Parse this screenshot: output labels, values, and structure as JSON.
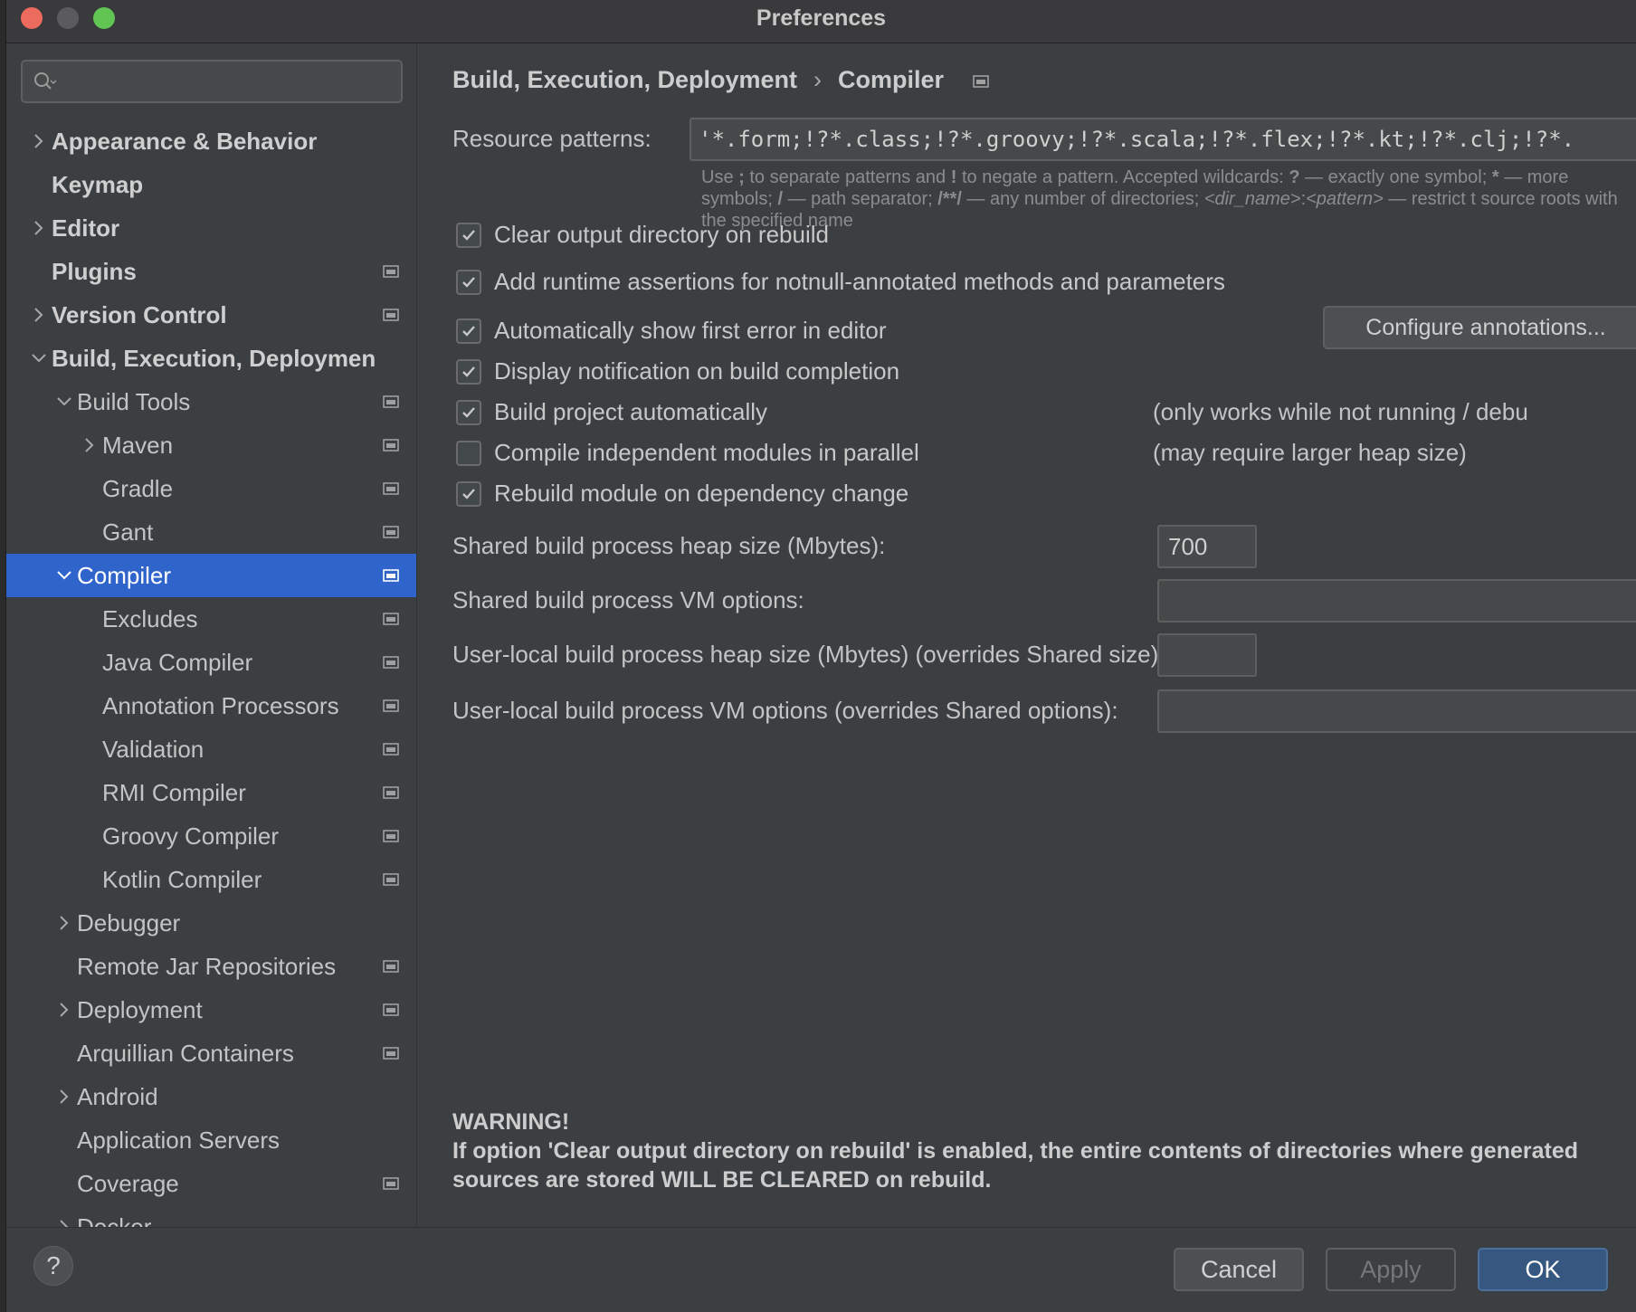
{
  "window": {
    "title": "Preferences"
  },
  "sidebar": {
    "search_placeholder": "",
    "items": [
      {
        "label": "Appearance & Behavior",
        "level": 0,
        "expander": "collapsed",
        "bold": true,
        "project_icon": false
      },
      {
        "label": "Keymap",
        "level": 0,
        "expander": "none",
        "bold": true,
        "project_icon": false
      },
      {
        "label": "Editor",
        "level": 0,
        "expander": "collapsed",
        "bold": true,
        "project_icon": false
      },
      {
        "label": "Plugins",
        "level": 0,
        "expander": "none",
        "bold": true,
        "project_icon": true
      },
      {
        "label": "Version Control",
        "level": 0,
        "expander": "collapsed",
        "bold": true,
        "project_icon": true
      },
      {
        "label": "Build, Execution, Deploymen",
        "level": 0,
        "expander": "expanded",
        "bold": true,
        "project_icon": false
      },
      {
        "label": "Build Tools",
        "level": 1,
        "expander": "expanded",
        "bold": false,
        "project_icon": true
      },
      {
        "label": "Maven",
        "level": 2,
        "expander": "collapsed",
        "bold": false,
        "project_icon": true
      },
      {
        "label": "Gradle",
        "level": 2,
        "expander": "none",
        "bold": false,
        "project_icon": true
      },
      {
        "label": "Gant",
        "level": 2,
        "expander": "none",
        "bold": false,
        "project_icon": true
      },
      {
        "label": "Compiler",
        "level": 1,
        "expander": "expanded",
        "bold": false,
        "project_icon": true,
        "selected": true
      },
      {
        "label": "Excludes",
        "level": 2,
        "expander": "none",
        "bold": false,
        "project_icon": true
      },
      {
        "label": "Java Compiler",
        "level": 2,
        "expander": "none",
        "bold": false,
        "project_icon": true
      },
      {
        "label": "Annotation Processors",
        "level": 2,
        "expander": "none",
        "bold": false,
        "project_icon": true
      },
      {
        "label": "Validation",
        "level": 2,
        "expander": "none",
        "bold": false,
        "project_icon": true
      },
      {
        "label": "RMI Compiler",
        "level": 2,
        "expander": "none",
        "bold": false,
        "project_icon": true
      },
      {
        "label": "Groovy Compiler",
        "level": 2,
        "expander": "none",
        "bold": false,
        "project_icon": true
      },
      {
        "label": "Kotlin Compiler",
        "level": 2,
        "expander": "none",
        "bold": false,
        "project_icon": true
      },
      {
        "label": "Debugger",
        "level": 1,
        "expander": "collapsed",
        "bold": false,
        "project_icon": false
      },
      {
        "label": "Remote Jar Repositories",
        "level": 1,
        "expander": "none",
        "bold": false,
        "project_icon": true
      },
      {
        "label": "Deployment",
        "level": 1,
        "expander": "collapsed",
        "bold": false,
        "project_icon": true
      },
      {
        "label": "Arquillian Containers",
        "level": 1,
        "expander": "none",
        "bold": false,
        "project_icon": true
      },
      {
        "label": "Android",
        "level": 1,
        "expander": "collapsed",
        "bold": false,
        "project_icon": false
      },
      {
        "label": "Application Servers",
        "level": 1,
        "expander": "none",
        "bold": false,
        "project_icon": false
      },
      {
        "label": "Coverage",
        "level": 1,
        "expander": "none",
        "bold": false,
        "project_icon": true
      },
      {
        "label": "Docker",
        "level": 1,
        "expander": "collapsed",
        "bold": false,
        "project_icon": false
      }
    ]
  },
  "main": {
    "breadcrumb": {
      "parent": "Build, Execution, Deployment",
      "separator": "›",
      "current": "Compiler"
    },
    "resource_patterns": {
      "label": "Resource patterns:",
      "value": "'*.form;!?*.class;!?*.groovy;!?*.scala;!?*.flex;!?*.kt;!?*.clj;!?*.",
      "hint": {
        "t1": "Use ",
        "b1": ";",
        "t2": " to separate patterns and ",
        "b2": "!",
        "t3": " to negate a pattern. Accepted wildcards: ",
        "b3": "?",
        "t4": " — exactly one symbol; ",
        "b4": "*",
        "t5": " — more symbols; ",
        "b5": "/",
        "t6": " — path separator; ",
        "b6": "/**/",
        "t7": " — any number of directories; ",
        "i1": "<dir_name>",
        "t8": ":",
        "i2": "<pattern>",
        "t9": " — restrict t source roots with the specified name"
      }
    },
    "options": [
      {
        "label": "Clear output directory on rebuild",
        "checked": true
      },
      {
        "label": "Add runtime assertions for notnull-annotated methods and parameters",
        "checked": true
      },
      {
        "label": "Automatically show first error in editor",
        "checked": true
      },
      {
        "label": "Display notification on build completion",
        "checked": true
      },
      {
        "label": "Build project automatically",
        "checked": true,
        "note": "(only works while not running / debu"
      },
      {
        "label": "Compile independent modules in parallel",
        "checked": false,
        "note": "(may require larger heap size)"
      },
      {
        "label": "Rebuild module on dependency change",
        "checked": true
      }
    ],
    "configure_button": "Configure annotations...",
    "fields": {
      "shared_heap": {
        "label": "Shared build process heap size (Mbytes):",
        "value": "700"
      },
      "shared_vm": {
        "label": "Shared build process VM options:",
        "value": ""
      },
      "local_heap": {
        "label": "User-local build process heap size (Mbytes) (overrides Shared size):",
        "value": ""
      },
      "local_vm": {
        "label": "User-local build process VM options (overrides Shared options):",
        "value": ""
      }
    },
    "warning": {
      "title": "WARNING!",
      "text": "If option 'Clear output directory on rebuild' is enabled, the entire contents of directories where generated sources are stored WILL BE CLEARED on rebuild."
    }
  },
  "footer": {
    "help": "?",
    "cancel": "Cancel",
    "apply": "Apply",
    "ok": "OK"
  },
  "colors": {
    "selection": "#2f65ca",
    "ok_button": "#365880",
    "background": "#3c3f41"
  }
}
